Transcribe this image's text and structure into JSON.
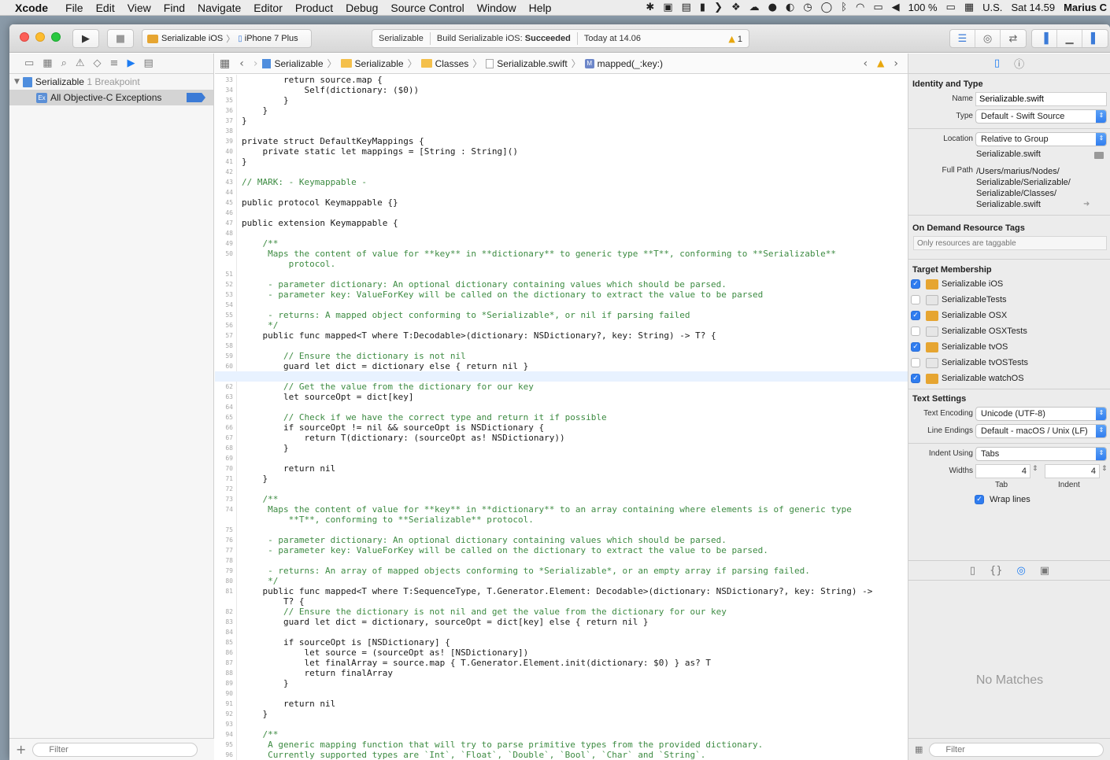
{
  "menubar": {
    "app": "Xcode",
    "items": [
      "File",
      "Edit",
      "View",
      "Find",
      "Navigate",
      "Editor",
      "Product",
      "Debug",
      "Source Control",
      "Window",
      "Help"
    ],
    "battery": "100 %",
    "input_source": "U.S.",
    "clock": "Sat 14.59",
    "user": "Marius C"
  },
  "toolbar": {
    "scheme": "Serializable iOS",
    "device": "iPhone 7 Plus",
    "activity_project": "Serializable",
    "activity_status_prefix": "Build Serializable iOS: ",
    "activity_status": "Succeeded",
    "activity_time": "Today at 14.06",
    "warning_count": "1"
  },
  "navigator": {
    "project": "Serializable",
    "project_detail": "1 Breakpoint",
    "breakpoint": "All Objective-C Exceptions",
    "filter_placeholder": "Filter"
  },
  "jumpbar": {
    "crumbs": [
      "Serializable",
      "Serializable",
      "Classes",
      "Serializable.swift",
      "mapped(_:key:)"
    ]
  },
  "editor": {
    "lines": [
      {
        "n": "33",
        "t": "        return source.map {"
      },
      {
        "n": "34",
        "t": "            Self(dictionary: ($0))"
      },
      {
        "n": "35",
        "t": "        }"
      },
      {
        "n": "36",
        "t": "    }"
      },
      {
        "n": "37",
        "t": "}"
      },
      {
        "n": "38",
        "t": ""
      },
      {
        "n": "39",
        "t": "private struct DefaultKeyMappings {"
      },
      {
        "n": "40",
        "t": "    private static let mappings = [String : String]()"
      },
      {
        "n": "41",
        "t": "}"
      },
      {
        "n": "42",
        "t": ""
      },
      {
        "n": "43",
        "t": "// MARK: - Keymappable -",
        "c": true
      },
      {
        "n": "44",
        "t": ""
      },
      {
        "n": "45",
        "t": "public protocol Keymappable {}"
      },
      {
        "n": "46",
        "t": ""
      },
      {
        "n": "47",
        "t": "public extension Keymappable {"
      },
      {
        "n": "48",
        "t": ""
      },
      {
        "n": "49",
        "t": "    /**",
        "c": true
      },
      {
        "n": "50",
        "t": "     Maps the content of value for **key** in **dictionary** to generic type **T**, conforming to **Serializable**",
        "c": true
      },
      {
        "n": "",
        "t": "         protocol.",
        "c": true
      },
      {
        "n": "51",
        "t": "",
        "c": true
      },
      {
        "n": "52",
        "t": "     - parameter dictionary: An optional dictionary containing values which should be parsed.",
        "c": true
      },
      {
        "n": "53",
        "t": "     - parameter key: ValueForKey will be called on the dictionary to extract the value to be parsed",
        "c": true
      },
      {
        "n": "54",
        "t": "",
        "c": true
      },
      {
        "n": "55",
        "t": "     - returns: A mapped object conforming to *Serializable*, or nil if parsing failed",
        "c": true
      },
      {
        "n": "56",
        "t": "     */",
        "c": true
      },
      {
        "n": "57",
        "t": "    public func mapped<T where T:Decodable>(dictionary: NSDictionary?, key: String) -> T? {"
      },
      {
        "n": "58",
        "t": ""
      },
      {
        "n": "59",
        "t": "        // Ensure the dictionary is not nil",
        "c": true
      },
      {
        "n": "60",
        "t": "        guard let dict = dictionary else { return nil }"
      },
      {
        "n": "61",
        "t": "",
        "cur": true
      },
      {
        "n": "62",
        "t": "        // Get the value from the dictionary for our key",
        "c": true
      },
      {
        "n": "63",
        "t": "        let sourceOpt = dict[key]"
      },
      {
        "n": "64",
        "t": ""
      },
      {
        "n": "65",
        "t": "        // Check if we have the correct type and return it if possible",
        "c": true
      },
      {
        "n": "66",
        "t": "        if sourceOpt != nil && sourceOpt is NSDictionary {"
      },
      {
        "n": "67",
        "t": "            return T(dictionary: (sourceOpt as! NSDictionary))"
      },
      {
        "n": "68",
        "t": "        }"
      },
      {
        "n": "69",
        "t": ""
      },
      {
        "n": "70",
        "t": "        return nil"
      },
      {
        "n": "71",
        "t": "    }"
      },
      {
        "n": "72",
        "t": ""
      },
      {
        "n": "73",
        "t": "    /**",
        "c": true
      },
      {
        "n": "74",
        "t": "     Maps the content of value for **key** in **dictionary** to an array containing where elements is of generic type",
        "c": true
      },
      {
        "n": "",
        "t": "         **T**, conforming to **Serializable** protocol.",
        "c": true
      },
      {
        "n": "75",
        "t": "",
        "c": true
      },
      {
        "n": "76",
        "t": "     - parameter dictionary: An optional dictionary containing values which should be parsed.",
        "c": true
      },
      {
        "n": "77",
        "t": "     - parameter key: ValueForKey will be called on the dictionary to extract the value to be parsed.",
        "c": true
      },
      {
        "n": "78",
        "t": "",
        "c": true
      },
      {
        "n": "79",
        "t": "     - returns: An array of mapped objects conforming to *Serializable*, or an empty array if parsing failed.",
        "c": true
      },
      {
        "n": "80",
        "t": "     */",
        "c": true
      },
      {
        "n": "81",
        "t": "    public func mapped<T where T:SequenceType, T.Generator.Element: Decodable>(dictionary: NSDictionary?, key: String) ->"
      },
      {
        "n": "",
        "t": "        T? {"
      },
      {
        "n": "82",
        "t": "        // Ensure the dictionary is not nil and get the value from the dictionary for our key",
        "c": true
      },
      {
        "n": "83",
        "t": "        guard let dict = dictionary, sourceOpt = dict[key] else { return nil }"
      },
      {
        "n": "84",
        "t": ""
      },
      {
        "n": "85",
        "t": "        if sourceOpt is [NSDictionary] {"
      },
      {
        "n": "86",
        "t": "            let source = (sourceOpt as! [NSDictionary])"
      },
      {
        "n": "87",
        "t": "            let finalArray = source.map { T.Generator.Element.init(dictionary: $0) } as? T"
      },
      {
        "n": "88",
        "t": "            return finalArray"
      },
      {
        "n": "89",
        "t": "        }"
      },
      {
        "n": "90",
        "t": ""
      },
      {
        "n": "91",
        "t": "        return nil"
      },
      {
        "n": "92",
        "t": "    }"
      },
      {
        "n": "93",
        "t": ""
      },
      {
        "n": "94",
        "t": "    /**",
        "c": true
      },
      {
        "n": "95",
        "t": "     A generic mapping function that will try to parse primitive types from the provided dictionary.",
        "c": true
      },
      {
        "n": "96",
        "t": "     Currently supported types are `Int`, `Float`, `Double`, `Bool`, `Char` and `String`.",
        "c": true
      }
    ]
  },
  "inspector": {
    "identity_title": "Identity and Type",
    "name_label": "Name",
    "name_value": "Serializable.swift",
    "type_label": "Type",
    "type_value": "Default - Swift Source",
    "location_label": "Location",
    "location_value": "Relative to Group",
    "location_file": "Serializable.swift",
    "fullpath_label": "Full Path",
    "fullpath_lines": [
      "/Users/marius/Nodes/",
      "Serializable/Serializable/",
      "Serializable/Classes/",
      "Serializable.swift"
    ],
    "ondemand_title": "On Demand Resource Tags",
    "ondemand_placeholder": "Only resources are taggable",
    "membership_title": "Target Membership",
    "targets": [
      {
        "name": "Serializable iOS",
        "checked": true
      },
      {
        "name": "SerializableTests",
        "checked": false
      },
      {
        "name": "Serializable OSX",
        "checked": true
      },
      {
        "name": "Serializable OSXTests",
        "checked": false
      },
      {
        "name": "Serializable tvOS",
        "checked": true
      },
      {
        "name": "Serializable tvOSTests",
        "checked": false
      },
      {
        "name": "Serializable watchOS",
        "checked": true
      }
    ],
    "text_title": "Text Settings",
    "encoding_label": "Text Encoding",
    "encoding_value": "Unicode (UTF-8)",
    "endings_label": "Line Endings",
    "endings_value": "Default - macOS / Unix (LF)",
    "indent_label": "Indent Using",
    "indent_value": "Tabs",
    "widths_label": "Widths",
    "tab_width": "4",
    "indent_width": "4",
    "tab_label": "Tab",
    "indent_sub_label": "Indent",
    "wrap_label": "Wrap lines",
    "no_matches": "No Matches",
    "filter_placeholder": "Filter"
  }
}
